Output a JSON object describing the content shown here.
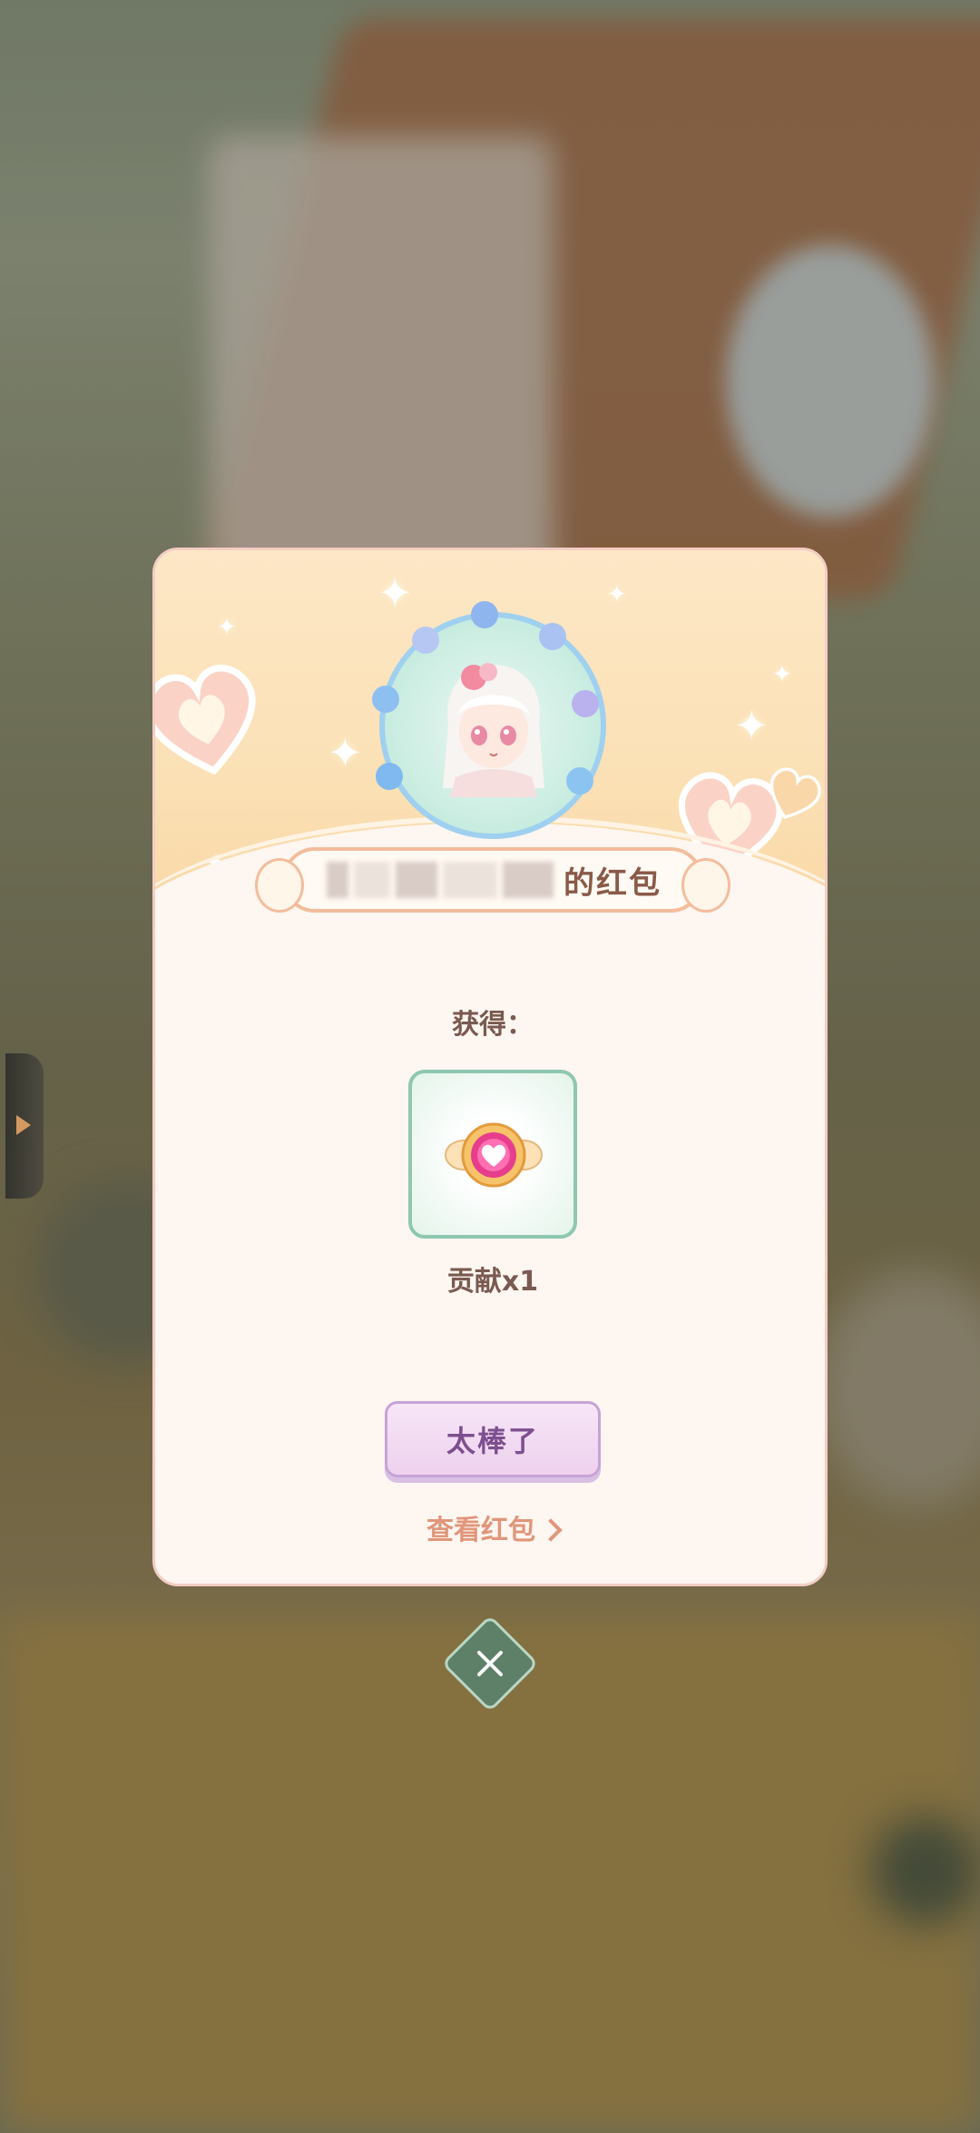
{
  "dialog": {
    "name_ribbon_suffix": "的红包",
    "obtain_label": "获得：",
    "reward": {
      "icon": "heart-emblem-icon",
      "name": "贡献x1"
    },
    "confirm_button_label": "太棒了",
    "view_link_label": "查看红包"
  },
  "colors": {
    "dialog_background": "#fdf6f1",
    "header_background": "#fbe0b4",
    "button_purple": "#eed1ee",
    "link_orange": "#e0967a",
    "close_green": "#5e8068"
  },
  "icons": [
    "side-tab-arrow-icon",
    "sparkle-icon",
    "heart-icon",
    "chevron-right-icon",
    "close-icon"
  ]
}
